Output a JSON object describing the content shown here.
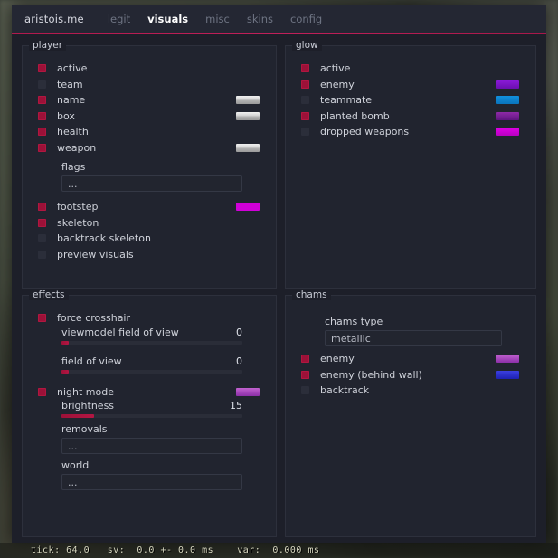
{
  "window": {
    "brand": "aristois.me",
    "tabs": [
      {
        "label": "legit",
        "active": false
      },
      {
        "label": "visuals",
        "active": true
      },
      {
        "label": "misc",
        "active": false
      },
      {
        "label": "skins",
        "active": false
      },
      {
        "label": "config",
        "active": false
      }
    ],
    "accent_color": "#b11a4d"
  },
  "panels": {
    "player": {
      "title": "player",
      "rows": [
        {
          "label": "active",
          "checked": true,
          "swatch": null
        },
        {
          "label": "team",
          "checked": false,
          "swatch": null
        },
        {
          "label": "name",
          "checked": true,
          "swatch": "#e0e0e0"
        },
        {
          "label": "box",
          "checked": true,
          "swatch": "#e0e0e0"
        },
        {
          "label": "health",
          "checked": true,
          "swatch": null
        },
        {
          "label": "weapon",
          "checked": true,
          "swatch": "#e0e0e0"
        }
      ],
      "flags_label": "flags",
      "flags_value": "...",
      "rows2": [
        {
          "label": "footstep",
          "checked": true,
          "swatch": "#d000d8"
        },
        {
          "label": "skeleton",
          "checked": true,
          "swatch": null
        },
        {
          "label": "backtrack skeleton",
          "checked": false,
          "swatch": null
        },
        {
          "label": "preview visuals",
          "checked": false,
          "swatch": null
        }
      ]
    },
    "glow": {
      "title": "glow",
      "rows": [
        {
          "label": "active",
          "checked": true,
          "swatch": null
        },
        {
          "label": "enemy",
          "checked": true,
          "swatch": "#8a1ad8"
        },
        {
          "label": "teammate",
          "checked": false,
          "swatch": "#1190dd"
        },
        {
          "label": "planted bomb",
          "checked": true,
          "swatch": "#8e2aa8"
        },
        {
          "label": "dropped weapons",
          "checked": false,
          "swatch": "#e200e8"
        }
      ]
    },
    "effects": {
      "title": "effects",
      "force_crosshair": {
        "label": "force crosshair",
        "checked": true
      },
      "viewmodel_fov": {
        "label": "viewmodel field of view",
        "value": "0",
        "percent": 4
      },
      "fov": {
        "label": "field of view",
        "value": "0",
        "percent": 4
      },
      "night_mode": {
        "label": "night mode",
        "checked": true,
        "swatch": "#c262d0"
      },
      "brightness": {
        "label": "brightness",
        "value": "15",
        "percent": 18
      },
      "removals": {
        "label": "removals",
        "value": "..."
      },
      "world": {
        "label": "world",
        "value": "..."
      }
    },
    "chams": {
      "title": "chams",
      "chams_type": {
        "label": "chams type",
        "value": "metallic"
      },
      "rows": [
        {
          "label": "enemy",
          "checked": true,
          "swatch": "#c262d0"
        },
        {
          "label": "enemy (behind wall)",
          "checked": true,
          "swatch": "#3b3fe0"
        },
        {
          "label": "backtrack",
          "checked": false,
          "swatch": null
        }
      ]
    }
  },
  "statusbar": {
    "text": "tick: 64.0   sv:  0.0 +- 0.0 ms    var:  0.000 ms"
  }
}
